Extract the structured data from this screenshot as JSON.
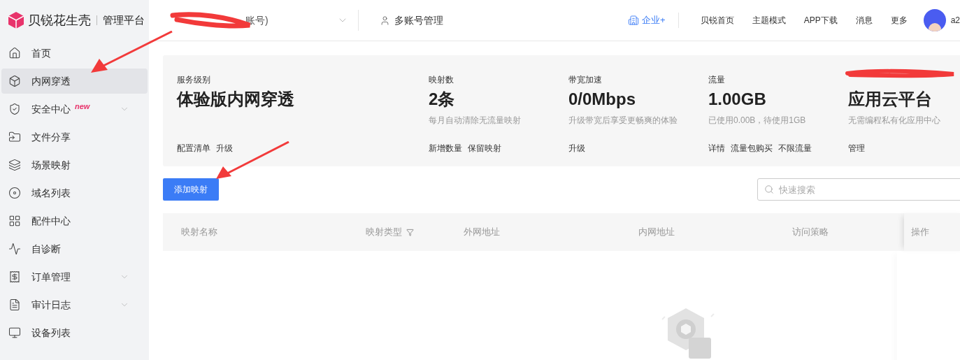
{
  "brand": {
    "name": "贝锐花生壳",
    "suffix": "管理平台"
  },
  "header": {
    "account": "账号)",
    "multi_account": "多账号管理",
    "enterprise": "企业+",
    "links": [
      "贝锐首页",
      "主题模式",
      "APP下载",
      "消息",
      "更多"
    ],
    "user": "a2"
  },
  "sidebar": {
    "items": [
      {
        "label": "首页",
        "selected": false,
        "has_submenu": false
      },
      {
        "label": "内网穿透",
        "selected": true,
        "has_submenu": false
      },
      {
        "label": "安全中心",
        "selected": false,
        "has_submenu": true,
        "badge": "new"
      },
      {
        "label": "文件分享",
        "selected": false,
        "has_submenu": false
      },
      {
        "label": "场景映射",
        "selected": false,
        "has_submenu": false
      },
      {
        "label": "域名列表",
        "selected": false,
        "has_submenu": false
      },
      {
        "label": "配件中心",
        "selected": false,
        "has_submenu": false
      },
      {
        "label": "自诊断",
        "selected": false,
        "has_submenu": false
      },
      {
        "label": "订单管理",
        "selected": false,
        "has_submenu": true
      },
      {
        "label": "审计日志",
        "selected": false,
        "has_submenu": true
      },
      {
        "label": "设备列表",
        "selected": false,
        "has_submenu": false
      }
    ]
  },
  "stats": [
    {
      "label": "服务级别",
      "value": "体验版内网穿透",
      "actions": [
        "配置清单",
        "升级"
      ]
    },
    {
      "label": "映射数",
      "value": "2条",
      "note": "每月自动清除无流量映射",
      "actions": [
        "新增数量",
        "保留映射"
      ]
    },
    {
      "label": "带宽加速",
      "value": "0/0Mbps",
      "note": "升级带宽后享受更畅爽的体验",
      "actions": [
        "升级"
      ]
    },
    {
      "label": "流量",
      "value": "1.00GB",
      "note": "已使用0.00B，待使用1GB",
      "actions": [
        "详情",
        "流量包购买",
        "不限流量"
      ]
    },
    {
      "value": "应用云平台",
      "note": "无需编程私有化应用中心",
      "actions": [
        "管理"
      ]
    }
  ],
  "add_button": "添加映射",
  "search": {
    "placeholder": "快速搜索"
  },
  "table": {
    "columns": [
      {
        "label": "映射名称"
      },
      {
        "label": "映射类型",
        "filter": true
      },
      {
        "label": "外网地址"
      },
      {
        "label": "内网地址"
      },
      {
        "label": "访问策略"
      },
      {
        "label": "操作"
      }
    ]
  }
}
